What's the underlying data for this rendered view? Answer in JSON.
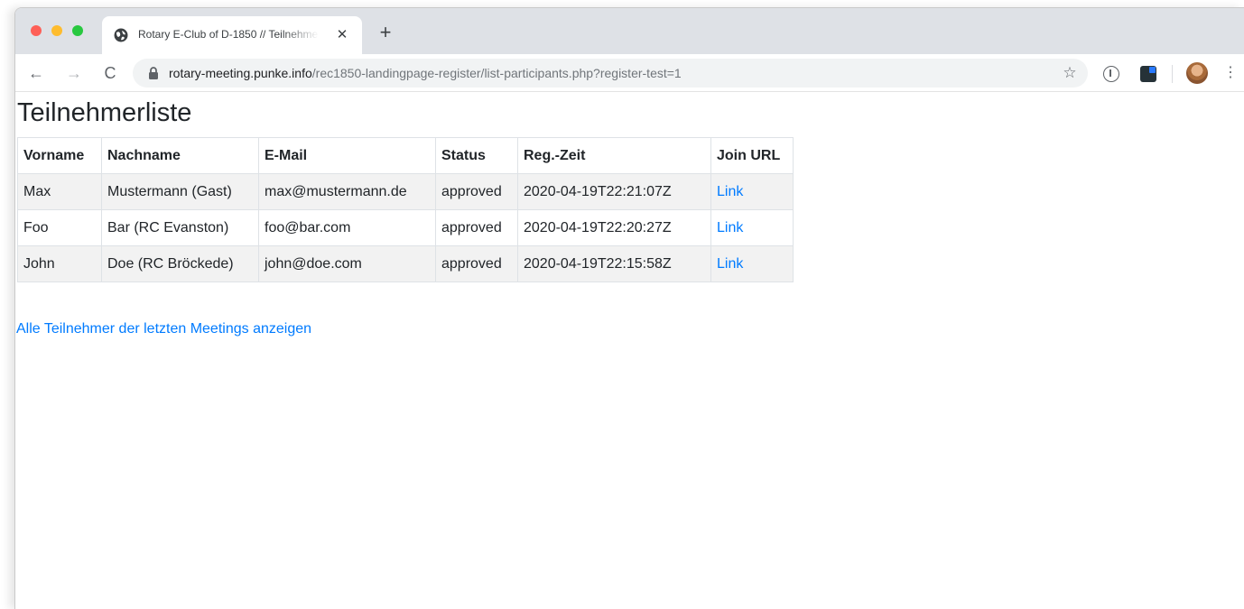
{
  "browser": {
    "tab": {
      "title": "Rotary E-Club of D-1850 // Teilnehmerliste",
      "close_icon": "✕"
    },
    "new_tab_icon": "+",
    "nav": {
      "back_icon": "←",
      "forward_icon": "→",
      "reload_icon": "C"
    },
    "address": {
      "domain": "rotary-meeting.punke.info",
      "path": "/rec1850-landingpage-register/list-participants.php?register-test=1"
    },
    "star_icon": "☆",
    "menu_icon": "⋮"
  },
  "page": {
    "title": "Teilnehmerliste",
    "table": {
      "headers": [
        "Vorname",
        "Nachname",
        "E-Mail",
        "Status",
        "Reg.-Zeit",
        "Join URL"
      ],
      "rows": [
        [
          "Max",
          "Mustermann (Gast)",
          "max@mustermann.de",
          "approved",
          "2020-04-19T22:21:07Z",
          "Link"
        ],
        [
          "Foo",
          "Bar (RC Evanston)",
          "foo@bar.com",
          "approved",
          "2020-04-19T22:20:27Z",
          "Link"
        ],
        [
          "John",
          "Doe (RC Bröckede)",
          "john@doe.com",
          "approved",
          "2020-04-19T22:15:58Z",
          "Link"
        ]
      ]
    },
    "all_participants_link": "Alle Teilnehmer der letzten Meetings anzeigen"
  },
  "colors": {
    "link": "#007bff",
    "tab_strip": "#dee1e6",
    "striped_row": "#f2f2f2"
  }
}
